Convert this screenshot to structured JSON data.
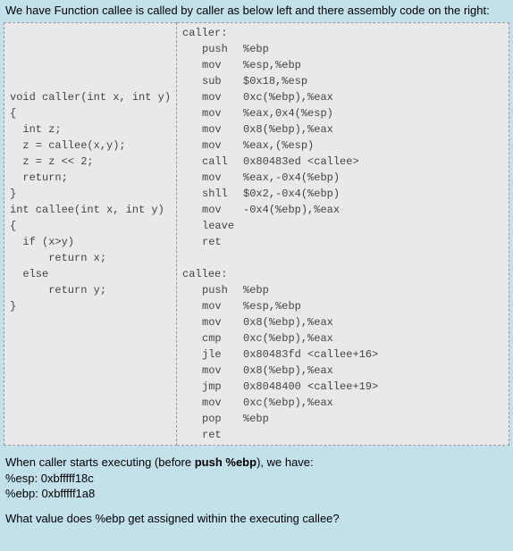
{
  "header": {
    "intro": "We have Function callee is called by caller as below left and there assembly code on the right:"
  },
  "source": {
    "blank_lines": 6,
    "lines": [
      "void caller(int x, int y)",
      "{",
      "  int z;",
      "  z = callee(x,y);",
      "  z = z << 2;",
      "  return;",
      "}",
      "int callee(int x, int y)",
      "{",
      "  if (x>y)",
      "      return x;",
      "  else",
      "      return y;",
      "}"
    ]
  },
  "asm": {
    "caller_label": "caller:",
    "caller": [
      {
        "mn": "push",
        "op": "%ebp"
      },
      {
        "mn": "mov",
        "op": "%esp,%ebp"
      },
      {
        "mn": "sub",
        "op": "$0x18,%esp"
      },
      {
        "mn": "mov",
        "op": "0xc(%ebp),%eax"
      },
      {
        "mn": "mov",
        "op": "%eax,0x4(%esp)"
      },
      {
        "mn": "mov",
        "op": "0x8(%ebp),%eax"
      },
      {
        "mn": "mov",
        "op": "%eax,(%esp)"
      },
      {
        "mn": "call",
        "op": "0x80483ed <callee>"
      },
      {
        "mn": "mov",
        "op": "%eax,-0x4(%ebp)"
      },
      {
        "mn": "shll",
        "op": "$0x2,-0x4(%ebp)"
      },
      {
        "mn": "mov",
        "op": "-0x4(%ebp),%eax"
      },
      {
        "mn": "leave",
        "op": ""
      },
      {
        "mn": "ret",
        "op": ""
      }
    ],
    "callee_label": "callee:",
    "callee": [
      {
        "mn": "push",
        "op": "%ebp"
      },
      {
        "mn": "mov",
        "op": "%esp,%ebp"
      },
      {
        "mn": "mov",
        "op": "0x8(%ebp),%eax"
      },
      {
        "mn": "cmp",
        "op": "0xc(%ebp),%eax"
      },
      {
        "mn": "jle",
        "op": "0x80483fd <callee+16>"
      },
      {
        "mn": "mov",
        "op": "0x8(%ebp),%eax"
      },
      {
        "mn": "jmp",
        "op": "0x8048400 <callee+19>"
      },
      {
        "mn": "mov",
        "op": "0xc(%ebp),%eax"
      },
      {
        "mn": "pop",
        "op": "%ebp"
      },
      {
        "mn": "ret",
        "op": ""
      }
    ]
  },
  "footer": {
    "line1": "When caller starts executing (before ",
    "bold1": "push %ebp",
    "line1b": "), we have:",
    "reg1": "%esp: 0xbfffff18c",
    "reg2": "%ebp: 0xbfffff1a8",
    "question": "What value does %ebp get assigned within the executing callee?"
  }
}
